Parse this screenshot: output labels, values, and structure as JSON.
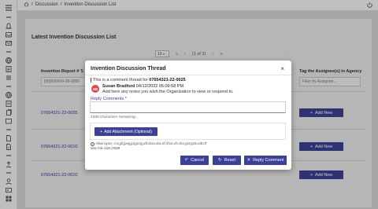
{
  "topbar": {
    "breadcrumb_sep1": "/",
    "breadcrumb_item1": "Discussion",
    "breadcrumb_sep2": "/",
    "breadcrumb_item2": "Invention Discussion List"
  },
  "page": {
    "title": "Latest Invention Discussion List",
    "pager": {
      "page_size": "10",
      "first": "«",
      "prev": "‹",
      "page_info": "(1 of 2)",
      "next": "›",
      "last": "»"
    },
    "columns": {
      "invention_report": "Invention Report #",
      "assignees": "Tag the Assignee(s) in Agency"
    },
    "filters": {
      "invention_report_placeholder": "[99]999999-99-9999",
      "assignee_placeholder": "Filter by Assignee..."
    },
    "rows": [
      {
        "report": "07654321-22-0025",
        "action": "Add New"
      },
      {
        "report": "07654321-22-0010",
        "action": "Add New"
      },
      {
        "report": "07654321-22-0010",
        "action": "Add New"
      }
    ]
  },
  "modal": {
    "title": "Invention Discussion Thread",
    "close": "×",
    "thread_prefix": "This is a comment thread for",
    "thread_id": "07654321-22-0025",
    "avatar_initials": "SB",
    "author_name": "Susan Bradford",
    "author_time": "04/12/2022 05:09:58 PM",
    "comment": "Add here any notes you wish the Organization to view or respond to.",
    "reply_label": "Reply Comments *",
    "reply_value": "",
    "chars_remaining": "1000 characters remaining.",
    "attach_button": "Add Attachment (Optional)",
    "allow_types": "Allow types: csv,gif,jpeg,jpg,png,pdf,docx,doc,tif,tif,txt,xls,xlsx,ppt,pptx,odt,rtf",
    "max_size": "Max File Size:25MB",
    "cancel_button": "Cancel",
    "reset_button": "Reset",
    "reply_button": "Reply Comment"
  },
  "colors": {
    "primary": "#3a4196",
    "avatar": "#d94b4b",
    "link": "#2a3aa8"
  },
  "icons": [
    "home-icon",
    "power-icon",
    "bell-icon",
    "mail-icon",
    "globe-icon",
    "document-icon",
    "file-icon",
    "upload-icon",
    "user-icon",
    "chevron-left-icon",
    "chevron-right-icon"
  ]
}
